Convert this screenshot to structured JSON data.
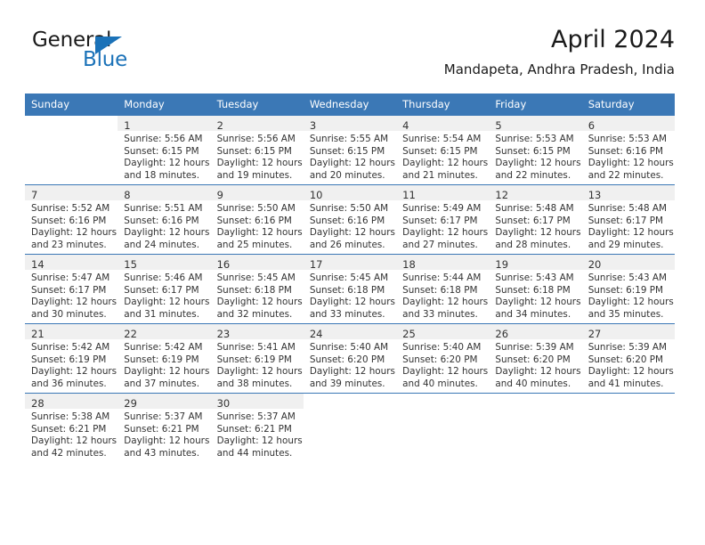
{
  "logo": {
    "word_one": "General",
    "word_two": "Blue",
    "accent_color": "#1b72b8",
    "triangle_icon": "triangle-icon"
  },
  "header": {
    "title": "April 2024",
    "subtitle": "Mandapeta, Andhra Pradesh, India"
  },
  "theme": {
    "header_bg": "#3b78b6",
    "header_text": "#ffffff",
    "daynum_band": "#f0f0f0",
    "body_text": "#333333"
  },
  "weekday_headers": [
    "Sunday",
    "Monday",
    "Tuesday",
    "Wednesday",
    "Thursday",
    "Friday",
    "Saturday"
  ],
  "weeks": [
    [
      {
        "day": "",
        "sunrise": "",
        "sunset": "",
        "daylight_line1": "",
        "daylight_line2": "",
        "blank": true
      },
      {
        "day": "1",
        "sunrise": "Sunrise: 5:56 AM",
        "sunset": "Sunset: 6:15 PM",
        "daylight_line1": "Daylight: 12 hours",
        "daylight_line2": "and 18 minutes."
      },
      {
        "day": "2",
        "sunrise": "Sunrise: 5:56 AM",
        "sunset": "Sunset: 6:15 PM",
        "daylight_line1": "Daylight: 12 hours",
        "daylight_line2": "and 19 minutes."
      },
      {
        "day": "3",
        "sunrise": "Sunrise: 5:55 AM",
        "sunset": "Sunset: 6:15 PM",
        "daylight_line1": "Daylight: 12 hours",
        "daylight_line2": "and 20 minutes."
      },
      {
        "day": "4",
        "sunrise": "Sunrise: 5:54 AM",
        "sunset": "Sunset: 6:15 PM",
        "daylight_line1": "Daylight: 12 hours",
        "daylight_line2": "and 21 minutes."
      },
      {
        "day": "5",
        "sunrise": "Sunrise: 5:53 AM",
        "sunset": "Sunset: 6:15 PM",
        "daylight_line1": "Daylight: 12 hours",
        "daylight_line2": "and 22 minutes."
      },
      {
        "day": "6",
        "sunrise": "Sunrise: 5:53 AM",
        "sunset": "Sunset: 6:16 PM",
        "daylight_line1": "Daylight: 12 hours",
        "daylight_line2": "and 22 minutes."
      }
    ],
    [
      {
        "day": "7",
        "sunrise": "Sunrise: 5:52 AM",
        "sunset": "Sunset: 6:16 PM",
        "daylight_line1": "Daylight: 12 hours",
        "daylight_line2": "and 23 minutes."
      },
      {
        "day": "8",
        "sunrise": "Sunrise: 5:51 AM",
        "sunset": "Sunset: 6:16 PM",
        "daylight_line1": "Daylight: 12 hours",
        "daylight_line2": "and 24 minutes."
      },
      {
        "day": "9",
        "sunrise": "Sunrise: 5:50 AM",
        "sunset": "Sunset: 6:16 PM",
        "daylight_line1": "Daylight: 12 hours",
        "daylight_line2": "and 25 minutes."
      },
      {
        "day": "10",
        "sunrise": "Sunrise: 5:50 AM",
        "sunset": "Sunset: 6:16 PM",
        "daylight_line1": "Daylight: 12 hours",
        "daylight_line2": "and 26 minutes."
      },
      {
        "day": "11",
        "sunrise": "Sunrise: 5:49 AM",
        "sunset": "Sunset: 6:17 PM",
        "daylight_line1": "Daylight: 12 hours",
        "daylight_line2": "and 27 minutes."
      },
      {
        "day": "12",
        "sunrise": "Sunrise: 5:48 AM",
        "sunset": "Sunset: 6:17 PM",
        "daylight_line1": "Daylight: 12 hours",
        "daylight_line2": "and 28 minutes."
      },
      {
        "day": "13",
        "sunrise": "Sunrise: 5:48 AM",
        "sunset": "Sunset: 6:17 PM",
        "daylight_line1": "Daylight: 12 hours",
        "daylight_line2": "and 29 minutes."
      }
    ],
    [
      {
        "day": "14",
        "sunrise": "Sunrise: 5:47 AM",
        "sunset": "Sunset: 6:17 PM",
        "daylight_line1": "Daylight: 12 hours",
        "daylight_line2": "and 30 minutes."
      },
      {
        "day": "15",
        "sunrise": "Sunrise: 5:46 AM",
        "sunset": "Sunset: 6:17 PM",
        "daylight_line1": "Daylight: 12 hours",
        "daylight_line2": "and 31 minutes."
      },
      {
        "day": "16",
        "sunrise": "Sunrise: 5:45 AM",
        "sunset": "Sunset: 6:18 PM",
        "daylight_line1": "Daylight: 12 hours",
        "daylight_line2": "and 32 minutes."
      },
      {
        "day": "17",
        "sunrise": "Sunrise: 5:45 AM",
        "sunset": "Sunset: 6:18 PM",
        "daylight_line1": "Daylight: 12 hours",
        "daylight_line2": "and 33 minutes."
      },
      {
        "day": "18",
        "sunrise": "Sunrise: 5:44 AM",
        "sunset": "Sunset: 6:18 PM",
        "daylight_line1": "Daylight: 12 hours",
        "daylight_line2": "and 33 minutes."
      },
      {
        "day": "19",
        "sunrise": "Sunrise: 5:43 AM",
        "sunset": "Sunset: 6:18 PM",
        "daylight_line1": "Daylight: 12 hours",
        "daylight_line2": "and 34 minutes."
      },
      {
        "day": "20",
        "sunrise": "Sunrise: 5:43 AM",
        "sunset": "Sunset: 6:19 PM",
        "daylight_line1": "Daylight: 12 hours",
        "daylight_line2": "and 35 minutes."
      }
    ],
    [
      {
        "day": "21",
        "sunrise": "Sunrise: 5:42 AM",
        "sunset": "Sunset: 6:19 PM",
        "daylight_line1": "Daylight: 12 hours",
        "daylight_line2": "and 36 minutes."
      },
      {
        "day": "22",
        "sunrise": "Sunrise: 5:42 AM",
        "sunset": "Sunset: 6:19 PM",
        "daylight_line1": "Daylight: 12 hours",
        "daylight_line2": "and 37 minutes."
      },
      {
        "day": "23",
        "sunrise": "Sunrise: 5:41 AM",
        "sunset": "Sunset: 6:19 PM",
        "daylight_line1": "Daylight: 12 hours",
        "daylight_line2": "and 38 minutes."
      },
      {
        "day": "24",
        "sunrise": "Sunrise: 5:40 AM",
        "sunset": "Sunset: 6:20 PM",
        "daylight_line1": "Daylight: 12 hours",
        "daylight_line2": "and 39 minutes."
      },
      {
        "day": "25",
        "sunrise": "Sunrise: 5:40 AM",
        "sunset": "Sunset: 6:20 PM",
        "daylight_line1": "Daylight: 12 hours",
        "daylight_line2": "and 40 minutes."
      },
      {
        "day": "26",
        "sunrise": "Sunrise: 5:39 AM",
        "sunset": "Sunset: 6:20 PM",
        "daylight_line1": "Daylight: 12 hours",
        "daylight_line2": "and 40 minutes."
      },
      {
        "day": "27",
        "sunrise": "Sunrise: 5:39 AM",
        "sunset": "Sunset: 6:20 PM",
        "daylight_line1": "Daylight: 12 hours",
        "daylight_line2": "and 41 minutes."
      }
    ],
    [
      {
        "day": "28",
        "sunrise": "Sunrise: 5:38 AM",
        "sunset": "Sunset: 6:21 PM",
        "daylight_line1": "Daylight: 12 hours",
        "daylight_line2": "and 42 minutes."
      },
      {
        "day": "29",
        "sunrise": "Sunrise: 5:37 AM",
        "sunset": "Sunset: 6:21 PM",
        "daylight_line1": "Daylight: 12 hours",
        "daylight_line2": "and 43 minutes."
      },
      {
        "day": "30",
        "sunrise": "Sunrise: 5:37 AM",
        "sunset": "Sunset: 6:21 PM",
        "daylight_line1": "Daylight: 12 hours",
        "daylight_line2": "and 44 minutes."
      },
      {
        "day": "",
        "sunrise": "",
        "sunset": "",
        "daylight_line1": "",
        "daylight_line2": "",
        "blank": true
      },
      {
        "day": "",
        "sunrise": "",
        "sunset": "",
        "daylight_line1": "",
        "daylight_line2": "",
        "blank": true
      },
      {
        "day": "",
        "sunrise": "",
        "sunset": "",
        "daylight_line1": "",
        "daylight_line2": "",
        "blank": true
      },
      {
        "day": "",
        "sunrise": "",
        "sunset": "",
        "daylight_line1": "",
        "daylight_line2": "",
        "blank": true
      }
    ]
  ]
}
